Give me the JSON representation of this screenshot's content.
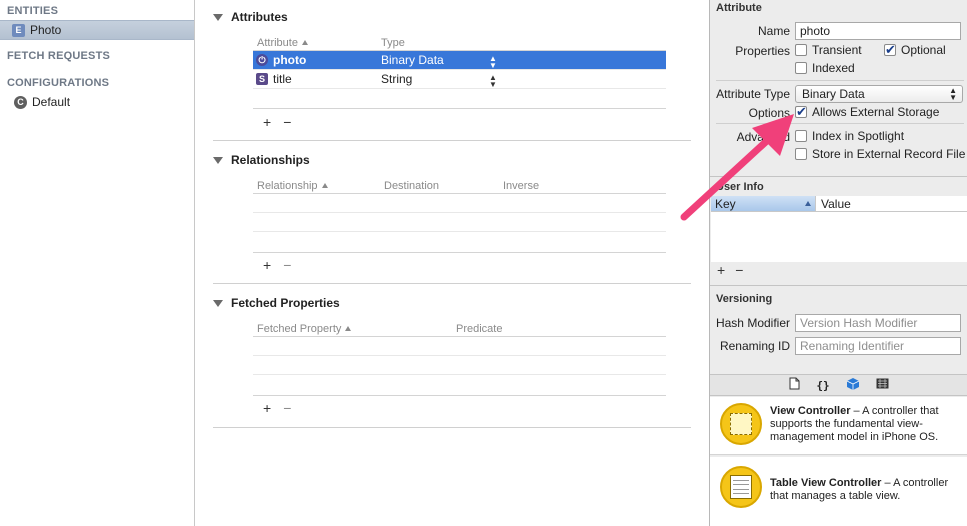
{
  "sidebar": {
    "entities_header": "ENTITIES",
    "entities": [
      {
        "badge": "E",
        "label": "Photo"
      }
    ],
    "fetch_requests_header": "FETCH REQUESTS",
    "configurations_header": "CONFIGURATIONS",
    "configurations": [
      {
        "badge": "C",
        "label": "Default"
      }
    ]
  },
  "attributes": {
    "title": "Attributes",
    "col_attribute": "Attribute",
    "col_type": "Type",
    "rows": [
      {
        "name": "photo",
        "type": "Binary Data",
        "icon": "binary-icon",
        "selected": true
      },
      {
        "name": "title",
        "type": "String",
        "icon": "string-icon",
        "selected": false
      }
    ]
  },
  "relationships": {
    "title": "Relationships",
    "col_relationship": "Relationship",
    "col_destination": "Destination",
    "col_inverse": "Inverse"
  },
  "fetched_properties": {
    "title": "Fetched Properties",
    "col_fetched_property": "Fetched Property",
    "col_predicate": "Predicate"
  },
  "inspector": {
    "section_title": "Attribute",
    "name_label": "Name",
    "name_value": "photo",
    "properties_label": "Properties",
    "transient_label": "Transient",
    "optional_label": "Optional",
    "indexed_label": "Indexed",
    "attribute_type_label": "Attribute Type",
    "attribute_type_value": "Binary Data",
    "options_label": "Options",
    "allows_external_label": "Allows External Storage",
    "advanced_label": "Advanced",
    "index_spotlight_label": "Index in Spotlight",
    "store_external_record_label": "Store in External Record File",
    "user_info_title": "User Info",
    "key_col": "Key",
    "value_col": "Value",
    "versioning_title": "Versioning",
    "hash_modifier_label": "Hash Modifier",
    "hash_modifier_placeholder": "Version Hash Modifier",
    "renaming_id_label": "Renaming ID",
    "renaming_id_placeholder": "Renaming Identifier"
  },
  "library": {
    "items": [
      {
        "title": "View Controller",
        "desc": " – A controller that supports the fundamental view-management model in iPhone OS."
      },
      {
        "title": "Table View Controller",
        "desc": " – A controller that manages a table view."
      }
    ]
  },
  "colors": {
    "accent": "#3877d9",
    "arrow": "#f0407a"
  }
}
